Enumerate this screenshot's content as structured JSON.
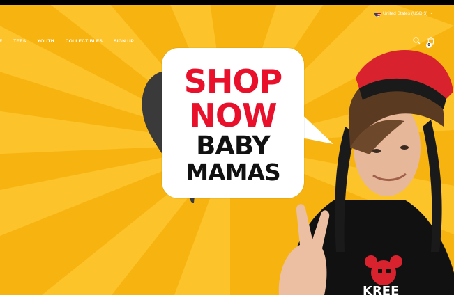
{
  "header": {
    "nav_items": [
      "KF",
      "TEES",
      "YOUTH",
      "COLLECTIBLES",
      "SIGN UP"
    ],
    "locale_label": "United States (USD $)",
    "cart_count": "0",
    "icons": [
      "search-icon",
      "cart-icon",
      "us-flag-icon",
      "chevron-down-icon"
    ]
  },
  "hero": {
    "bubble_lines": [
      "SHOP",
      "NOW",
      "BABY",
      "MAMAS"
    ],
    "colors": {
      "background": "#f7b411",
      "rays": "#ffc933",
      "accent_red": "#e9102b",
      "text_black": "#111111",
      "bubble": "#ffffff"
    }
  }
}
